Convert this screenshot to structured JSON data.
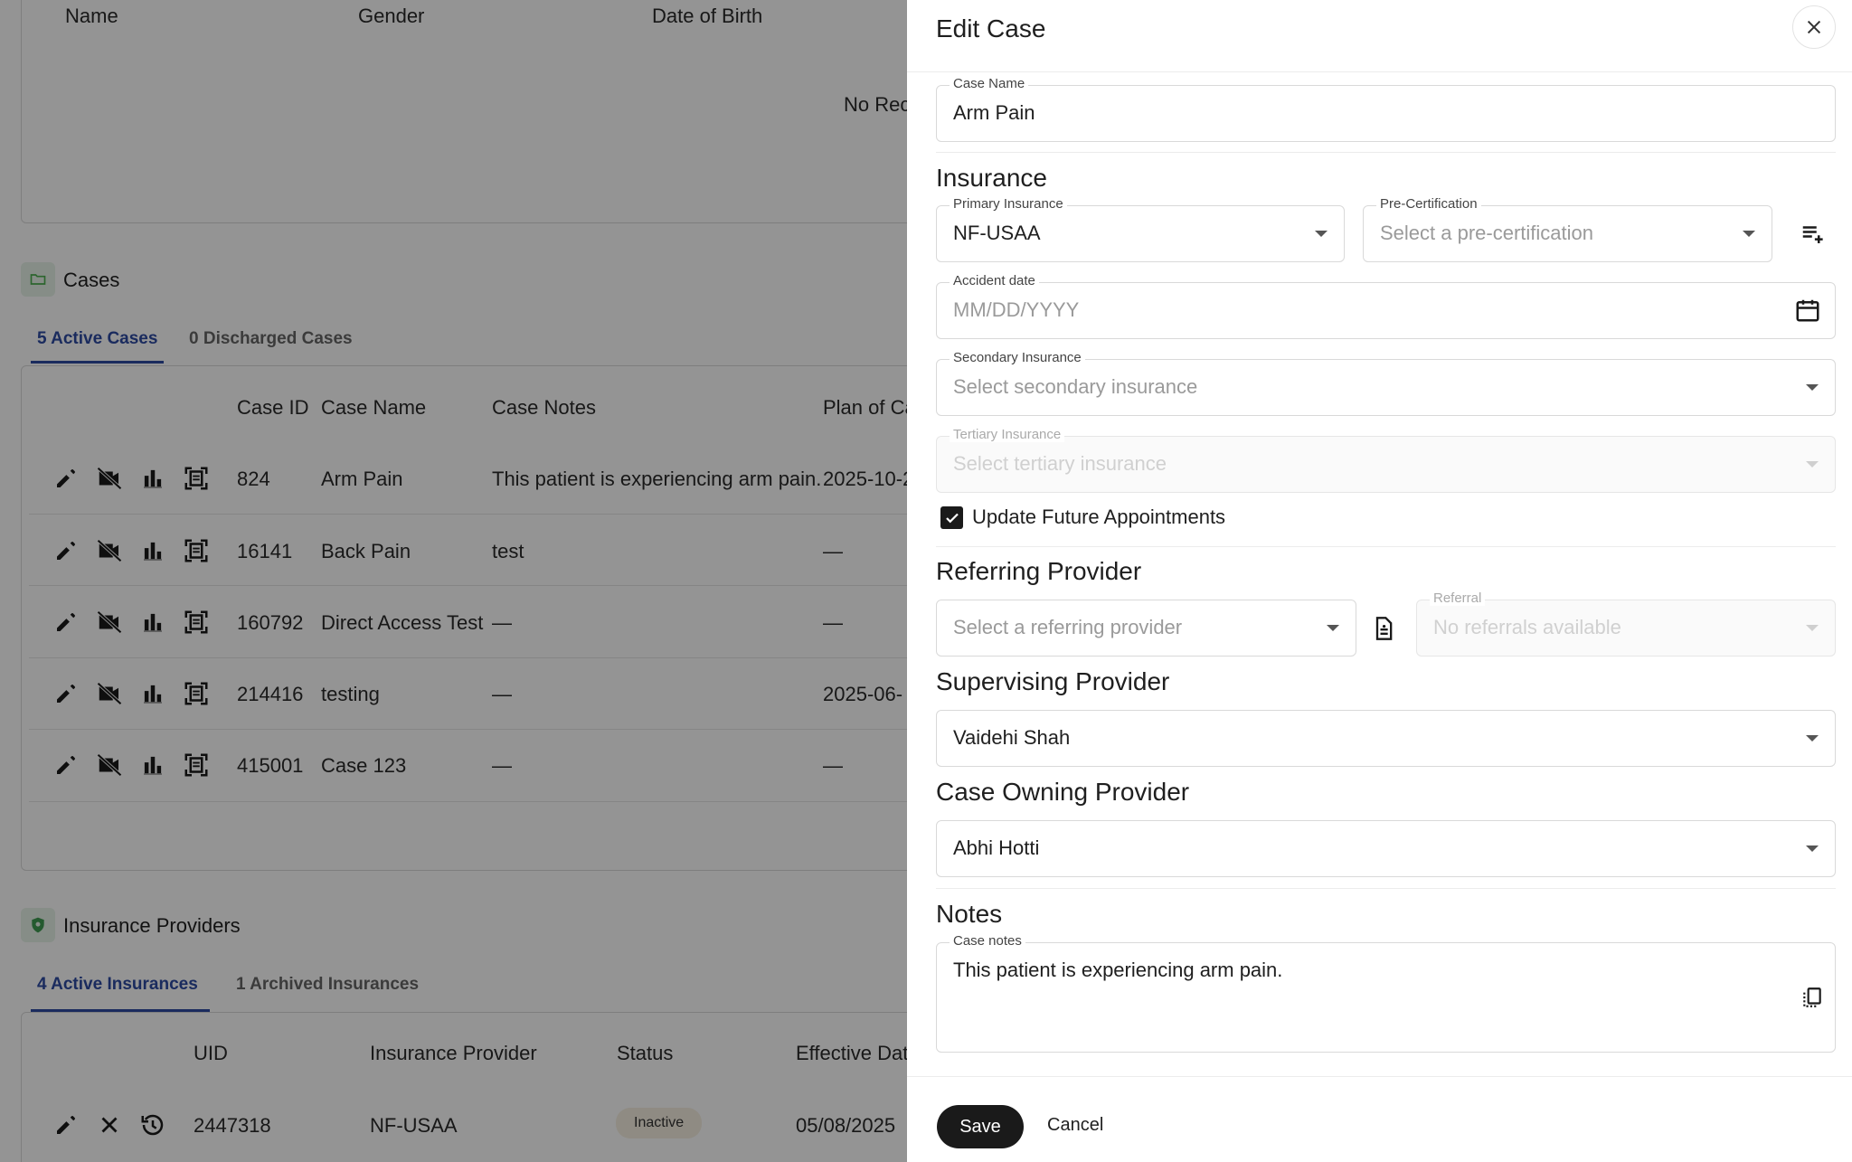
{
  "patients_table": {
    "headers": [
      "Name",
      "Gender",
      "Date of Birth"
    ],
    "empty_text": "No Rec"
  },
  "cases": {
    "title": "Cases",
    "tabs": [
      {
        "label": "5 Active Cases",
        "active": true
      },
      {
        "label": "0 Discharged Cases",
        "active": false
      }
    ],
    "headers": [
      "Case ID",
      "Case Name",
      "Case Notes",
      "Plan of Ca"
    ],
    "rows": [
      {
        "id": "824",
        "name": "Arm Pain",
        "notes": "This patient is experiencing arm pain.",
        "plan": "2025-10-2"
      },
      {
        "id": "16141",
        "name": "Back Pain",
        "notes": "test",
        "plan": "—"
      },
      {
        "id": "160792",
        "name": "Direct Access Test",
        "notes": "—",
        "plan": "—"
      },
      {
        "id": "214416",
        "name": "testing",
        "notes": "—",
        "plan": "2025-06-"
      },
      {
        "id": "415001",
        "name": "Case 123",
        "notes": "—",
        "plan": "—"
      }
    ]
  },
  "insurance": {
    "title": "Insurance Providers",
    "tabs": [
      {
        "label": "4 Active Insurances",
        "active": true
      },
      {
        "label": "1 Archived Insurances",
        "active": false
      }
    ],
    "headers": [
      "UID",
      "Insurance Provider",
      "Status",
      "Effective Date"
    ],
    "rows": [
      {
        "uid": "2447318",
        "provider": "NF-USAA",
        "status": "Inactive",
        "effective": "05/08/2025"
      }
    ]
  },
  "drawer": {
    "title": "Edit Case",
    "case_name": {
      "label": "Case Name",
      "value": "Arm Pain"
    },
    "insurance_heading": "Insurance",
    "primary_insurance": {
      "label": "Primary Insurance",
      "value": "NF-USAA"
    },
    "pre_certification": {
      "label": "Pre-Certification",
      "placeholder": "Select a pre-certification"
    },
    "accident_date": {
      "label": "Accident date",
      "placeholder": "MM/DD/YYYY"
    },
    "secondary_insurance": {
      "label": "Secondary Insurance",
      "placeholder": "Select secondary insurance"
    },
    "tertiary_insurance": {
      "label": "Tertiary Insurance",
      "placeholder": "Select tertiary insurance"
    },
    "update_future": {
      "label": "Update Future Appointments",
      "checked": true
    },
    "referring_heading": "Referring Provider",
    "referring_provider": {
      "placeholder": "Select a referring provider"
    },
    "referral": {
      "label": "Referral",
      "placeholder": "No referrals available"
    },
    "supervising_heading": "Supervising Provider",
    "supervising_provider": {
      "value": "Vaidehi Shah"
    },
    "owning_heading": "Case Owning Provider",
    "owning_provider": {
      "value": "Abhi Hotti"
    },
    "notes_heading": "Notes",
    "case_notes": {
      "label": "Case notes",
      "value": "This patient is experiencing arm pain."
    },
    "save_label": "Save",
    "cancel_label": "Cancel"
  },
  "colors": {
    "accent": "#2d4aa3",
    "primary_button": "#1a1a1a",
    "overlay": "rgba(0,0,0,0.42)",
    "badge_inactive": "#f7f0e2"
  },
  "icons": [
    "pencil-icon",
    "videocam-off-icon",
    "bar-chart-icon",
    "document-scan-icon",
    "close-icon",
    "history-icon",
    "folder-icon",
    "shield-icon",
    "playlist-add-icon",
    "calendar-icon",
    "file-icon",
    "copy-icon",
    "check-icon"
  ]
}
